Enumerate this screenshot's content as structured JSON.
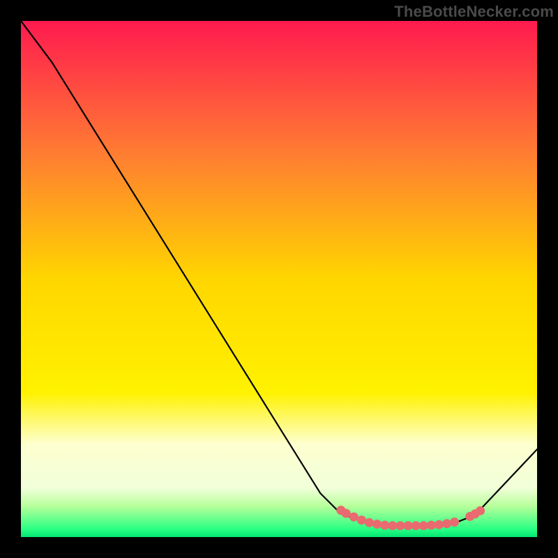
{
  "watermark": "TheBottleNecker.com",
  "chart_data": {
    "type": "line",
    "title": "",
    "xlabel": "",
    "ylabel": "",
    "xlim": [
      0,
      100
    ],
    "ylim": [
      0,
      100
    ],
    "background_gradient": {
      "stops": [
        {
          "offset": 0,
          "color": "#ff1a4f"
        },
        {
          "offset": 0.25,
          "color": "#ff7a33"
        },
        {
          "offset": 0.5,
          "color": "#ffd600"
        },
        {
          "offset": 0.72,
          "color": "#fff200"
        },
        {
          "offset": 0.82,
          "color": "#fdffcf"
        },
        {
          "offset": 0.905,
          "color": "#f1ffd9"
        },
        {
          "offset": 0.94,
          "color": "#b7ff9b"
        },
        {
          "offset": 0.985,
          "color": "#29ff83"
        },
        {
          "offset": 1.0,
          "color": "#00e673"
        }
      ]
    },
    "curve": [
      {
        "x": 0,
        "y": 100
      },
      {
        "x": 6,
        "y": 92
      },
      {
        "x": 58,
        "y": 8.5
      },
      {
        "x": 62,
        "y": 4.5
      },
      {
        "x": 68,
        "y": 2.5
      },
      {
        "x": 78,
        "y": 2.2
      },
      {
        "x": 84,
        "y": 2.7
      },
      {
        "x": 88,
        "y": 4.3
      },
      {
        "x": 100,
        "y": 17
      }
    ],
    "highlight_points": [
      {
        "x": 62,
        "y": 5.2
      },
      {
        "x": 63,
        "y": 4.6
      },
      {
        "x": 64.5,
        "y": 3.9
      },
      {
        "x": 66,
        "y": 3.3
      },
      {
        "x": 67.5,
        "y": 2.8
      },
      {
        "x": 69,
        "y": 2.5
      },
      {
        "x": 70.5,
        "y": 2.3
      },
      {
        "x": 72,
        "y": 2.2
      },
      {
        "x": 73.5,
        "y": 2.2
      },
      {
        "x": 75,
        "y": 2.2
      },
      {
        "x": 76.5,
        "y": 2.2
      },
      {
        "x": 78,
        "y": 2.2
      },
      {
        "x": 79.5,
        "y": 2.3
      },
      {
        "x": 81,
        "y": 2.4
      },
      {
        "x": 82.5,
        "y": 2.6
      },
      {
        "x": 84,
        "y": 2.9
      },
      {
        "x": 87,
        "y": 4.0
      },
      {
        "x": 88,
        "y": 4.5
      },
      {
        "x": 89,
        "y": 5.1
      }
    ],
    "highlight_color": "#e96a6f",
    "line_color": "#000000"
  }
}
